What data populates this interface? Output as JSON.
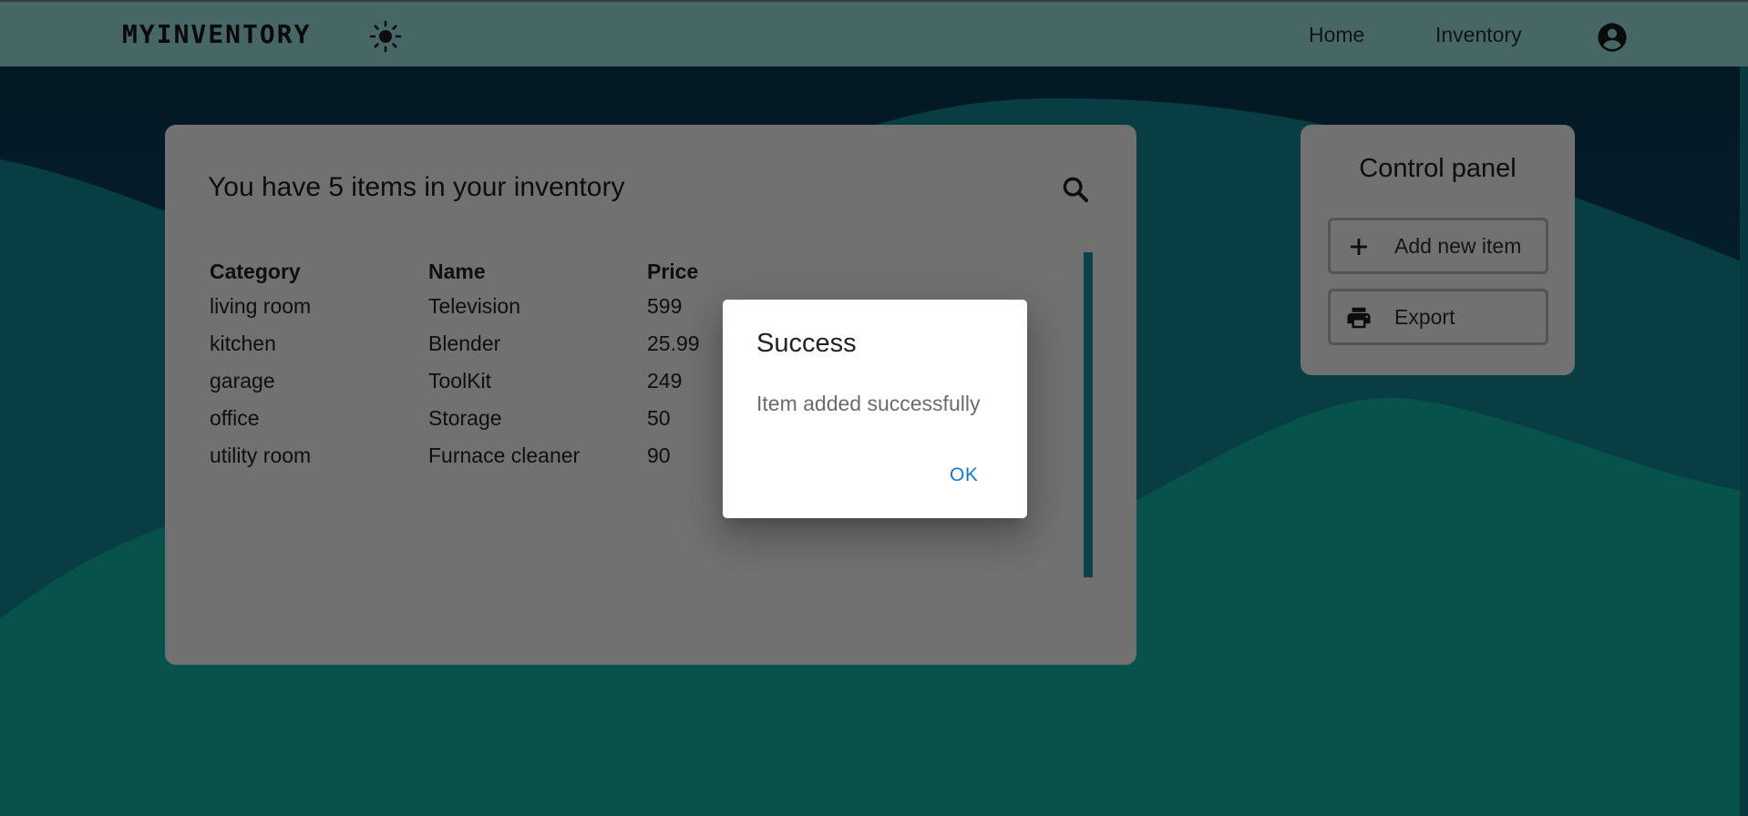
{
  "app": {
    "logo": "MYINVENTORY"
  },
  "nav": {
    "items": [
      {
        "label": "Home"
      },
      {
        "label": "Inventory"
      }
    ],
    "theme_icon": "sun-icon",
    "account_icon": "account-circle-icon"
  },
  "inventory": {
    "title": "You have 5 items in your inventory",
    "search_icon": "search-icon",
    "columns": [
      "Category",
      "Name",
      "Price"
    ],
    "rows": [
      [
        "living room",
        "Television",
        "599"
      ],
      [
        "kitchen",
        "Blender",
        "25.99"
      ],
      [
        "garage",
        "ToolKit",
        "249"
      ],
      [
        "office",
        "Storage",
        "50"
      ],
      [
        "utility room",
        "Furnace cleaner",
        "90"
      ]
    ]
  },
  "control_panel": {
    "title": "Control panel",
    "add_label": "Add new item",
    "export_label": "Export",
    "add_icon": "plus-icon",
    "export_icon": "printer-icon"
  },
  "dialog": {
    "title": "Success",
    "message": "Item added successfully",
    "ok_label": "OK"
  },
  "colors": {
    "topbar": "#5b8585",
    "wave_dark": "#0a3545",
    "wave_mid": "#0b5a5a",
    "wave_light": "#0a7566",
    "card": "#919191",
    "accent": "#1976d2"
  }
}
